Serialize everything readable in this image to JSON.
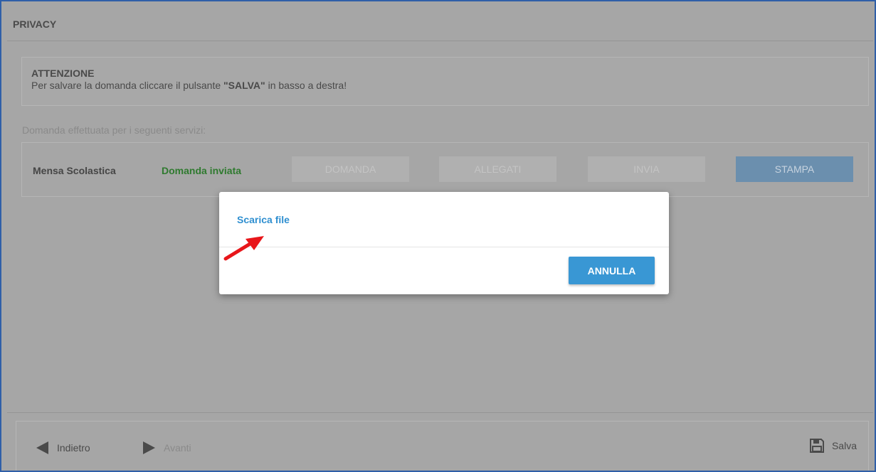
{
  "header": {
    "title": "PRIVACY"
  },
  "alert": {
    "title": "ATTENZIONE",
    "text_before": "Per salvare la domanda cliccare il pulsante ",
    "text_bold": "\"SALVA\"",
    "text_after": " in basso a destra!"
  },
  "services": {
    "label": "Domanda effettuata per i seguenti servizi:",
    "items": [
      {
        "name": "Mensa Scolastica",
        "status": "Domanda inviata",
        "buttons": [
          "DOMANDA",
          "ALLEGATI",
          "INVIA",
          "STAMPA"
        ]
      }
    ]
  },
  "footer": {
    "back_label": "Indietro",
    "next_label": "Avanti",
    "save_label": "Salva"
  },
  "dialog": {
    "link_label": "Scarica file",
    "cancel_label": "ANNULLA"
  },
  "colors": {
    "overlay_background": "#a6a6a6",
    "status_green": "#2f7a2f",
    "link_blue": "#2f8fd0",
    "button_blue": "#3997d4",
    "annotation_arrow": "#e8161a"
  },
  "icons": {
    "back": "triangle-left-icon",
    "next": "triangle-right-icon",
    "save": "floppy-disk-icon"
  }
}
